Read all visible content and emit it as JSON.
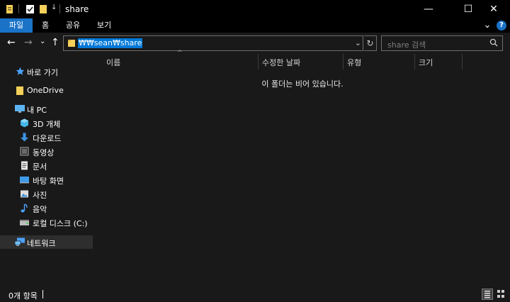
{
  "window": {
    "title": "share",
    "minimize_glyph": "—",
    "maximize_glyph": "☐",
    "close_glyph": "✕"
  },
  "quick_access": {
    "pin_glyph": "↓"
  },
  "ribbon": {
    "tabs": [
      {
        "label": "파일",
        "active": true
      },
      {
        "label": "홈",
        "active": false
      },
      {
        "label": "공유",
        "active": false
      },
      {
        "label": "보기",
        "active": false
      }
    ],
    "collapse_glyph": "⌄",
    "help_glyph": "?"
  },
  "address": {
    "path": "₩₩sean₩share",
    "dropdown_glyph": "⌄",
    "refresh_glyph": "↻",
    "back_glyph": "←",
    "forward_glyph": "→",
    "recent_glyph": "⌄",
    "up_glyph": "↑"
  },
  "search": {
    "placeholder": "share 검색",
    "icon": "search-icon"
  },
  "sidebar": {
    "items": [
      {
        "label": "바로 가기",
        "icon": "star-icon"
      },
      {
        "label": "OneDrive",
        "icon": "folder-icon"
      },
      {
        "label": "내 PC",
        "icon": "monitor-icon"
      },
      {
        "label": "3D 개체",
        "icon": "cube-icon"
      },
      {
        "label": "다운로드",
        "icon": "download-icon"
      },
      {
        "label": "동영상",
        "icon": "video-icon"
      },
      {
        "label": "문서",
        "icon": "document-icon"
      },
      {
        "label": "바탕 화면",
        "icon": "desktop-icon"
      },
      {
        "label": "사진",
        "icon": "picture-icon"
      },
      {
        "label": "음악",
        "icon": "music-icon"
      },
      {
        "label": "로컬 디스크 (C:)",
        "icon": "drive-icon"
      },
      {
        "label": "네트워크",
        "icon": "network-icon"
      }
    ]
  },
  "columns": [
    {
      "label": "이름"
    },
    {
      "label": "수정한 날짜"
    },
    {
      "label": "유형"
    },
    {
      "label": "크기"
    }
  ],
  "content": {
    "empty_message": "이 폴더는 비어 있습니다.",
    "sort_glyph": "^"
  },
  "status": {
    "item_count": "0개 항목"
  },
  "colors": {
    "accent": "#1a73c7",
    "selection": "#0078d7",
    "background": "#191919",
    "titlebar": "#000000"
  }
}
